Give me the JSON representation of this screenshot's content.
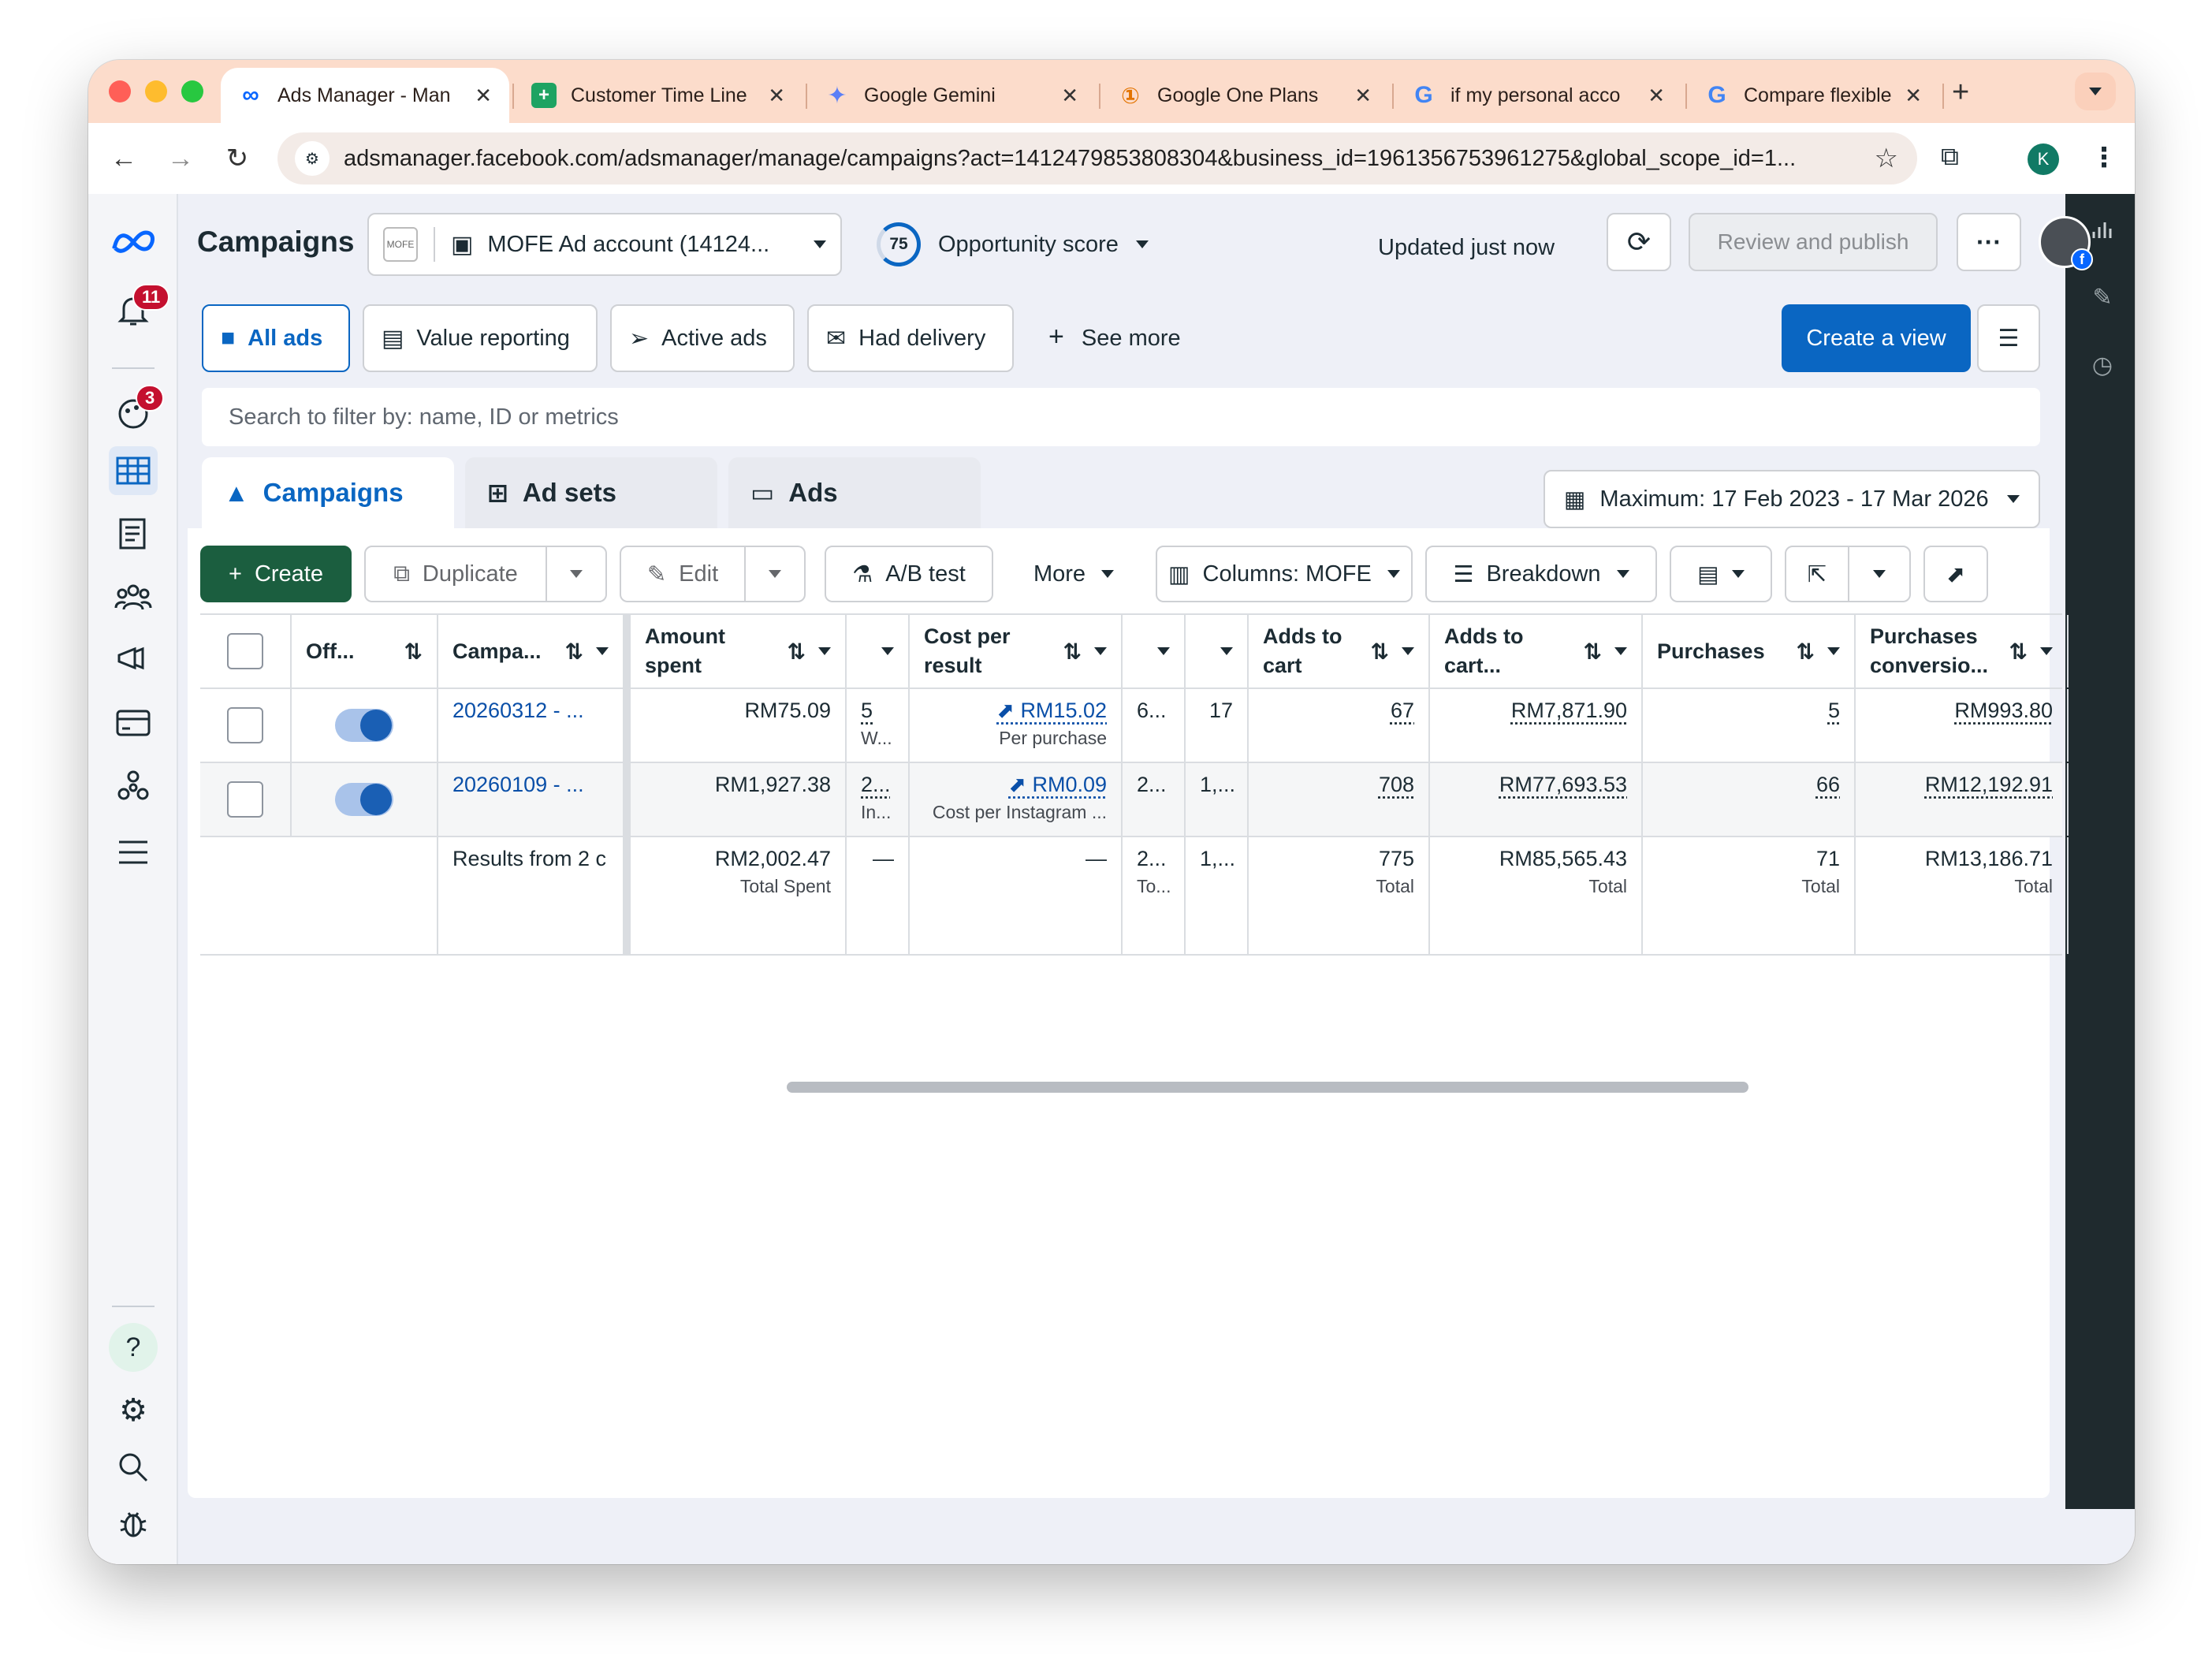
{
  "browser": {
    "tabs": [
      {
        "title": "Ads Manager - Man",
        "favicon": "meta-icon"
      },
      {
        "title": "Customer Time Line",
        "favicon": "sheets-icon"
      },
      {
        "title": "Google Gemini",
        "favicon": "gemini-icon"
      },
      {
        "title": "Google One Plans",
        "favicon": "google-one-icon"
      },
      {
        "title": "if my personal acco",
        "favicon": "google-icon"
      },
      {
        "title": "Compare flexible pr",
        "favicon": "google-icon"
      }
    ],
    "url": "adsmanager.facebook.com/adsmanager/manage/campaigns?act=1412479853808304&business_id=1961356753961275&global_scope_id=1...",
    "profile_initial": "K"
  },
  "leftnav": {
    "notifications_badge": "11",
    "activity_badge": "3",
    "help_label": "?"
  },
  "header": {
    "title": "Campaigns",
    "account_logo": "MOFE",
    "account_label": "MOFE Ad account (14124...",
    "opportunity_score": "75",
    "opportunity_label": "Opportunity score",
    "updated": "Updated just now",
    "review_publish": "Review and publish",
    "more": "···"
  },
  "views": {
    "all_ads": "All ads",
    "value_reporting": "Value reporting",
    "active_ads": "Active ads",
    "had_delivery": "Had delivery",
    "see_more": "See more",
    "create_view": "Create a view"
  },
  "search": {
    "placeholder": "Search to filter by: name, ID or metrics"
  },
  "levels": {
    "campaigns": "Campaigns",
    "ad_sets": "Ad sets",
    "ads": "Ads"
  },
  "date_range": "Maximum: 17 Feb 2023 - 17 Mar 2026",
  "actions": {
    "create": "Create",
    "duplicate": "Duplicate",
    "edit": "Edit",
    "ab_test": "A/B test",
    "more": "More",
    "columns": "Columns: MOFE",
    "breakdown": "Breakdown"
  },
  "table": {
    "headers": {
      "off": "Off...",
      "campaign": "Campa...",
      "amount_spent": "Amount spent",
      "cost_per_result": "Cost per result",
      "adds_to_cart": "Adds to cart",
      "adds_to_cart_value": "Adds to cart...",
      "purchases": "Purchases",
      "purchases_conversion": "Purchases conversio..."
    },
    "rows": [
      {
        "campaign": "20260312 - ...",
        "amount_spent": "RM75.09",
        "results": "5",
        "results_sub": "W...",
        "cost_per_result": "RM15.02",
        "cost_sub": "Per purchase",
        "col_a": "6...",
        "col_b": "17",
        "adds_to_cart": "67",
        "adds_to_cart_value": "RM7,871.90",
        "purchases": "5",
        "purchases_value": "RM993.80"
      },
      {
        "campaign": "20260109 - ...",
        "amount_spent": "RM1,927.38",
        "results": "2...",
        "results_sub": "In...",
        "cost_per_result": "RM0.09",
        "cost_sub": "Cost per Instagram ...",
        "col_a": "2...",
        "col_b": "1,...",
        "adds_to_cart": "708",
        "adds_to_cart_value": "RM77,693.53",
        "purchases": "66",
        "purchases_value": "RM12,192.91"
      }
    ],
    "footer": {
      "label": "Results from 2 c",
      "amount_spent": "RM2,002.47",
      "amount_sub": "Total Spent",
      "results": "—",
      "cost_per_result": "—",
      "col_a": "2...",
      "col_a_sub": "To...",
      "col_b": "1,...",
      "adds_to_cart": "775",
      "adds_to_cart_value": "RM85,565.43",
      "purchases": "71",
      "purchases_value": "RM13,186.71",
      "total_label": "Total"
    }
  }
}
